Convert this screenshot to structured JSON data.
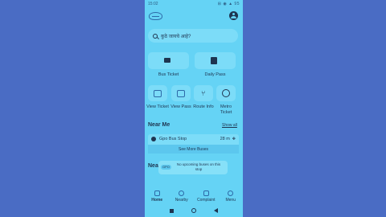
{
  "status_bar": {
    "time": "15:02",
    "icons": "⊞ ◉ ▲ 95"
  },
  "search": {
    "placeholder": "कुठे जायचे आहे?"
  },
  "quick_actions": [
    {
      "label": "Bus Ticket",
      "icon": "ticket-icon"
    },
    {
      "label": "Daily Pass",
      "icon": "pass-icon"
    }
  ],
  "services": [
    {
      "label": "View Ticket",
      "icon": "ticket-view-icon"
    },
    {
      "label": "View Pass",
      "icon": "pass-view-icon"
    },
    {
      "label": "Route Info",
      "icon": "route-icon"
    },
    {
      "label": "Metro Ticket",
      "icon": "metro-icon"
    }
  ],
  "near_me": {
    "title": "Near Me",
    "show_all": "Show all",
    "stop_name": "Gpo Bus Stop",
    "distance": "28 m",
    "see_more": "See More Buses"
  },
  "second_section_title": "Nea",
  "toast": {
    "badge": "GPO",
    "message": "No upcoming buses on this stop"
  },
  "bottom_nav": [
    {
      "label": "Home",
      "active": true
    },
    {
      "label": "Nearby",
      "active": false
    },
    {
      "label": "Complaint",
      "active": false
    },
    {
      "label": "Menu",
      "active": false
    }
  ],
  "colors": {
    "screen": "#65d3f5",
    "card": "#7cdcf8",
    "text": "#1e3450",
    "background": "#4a6cc4"
  }
}
